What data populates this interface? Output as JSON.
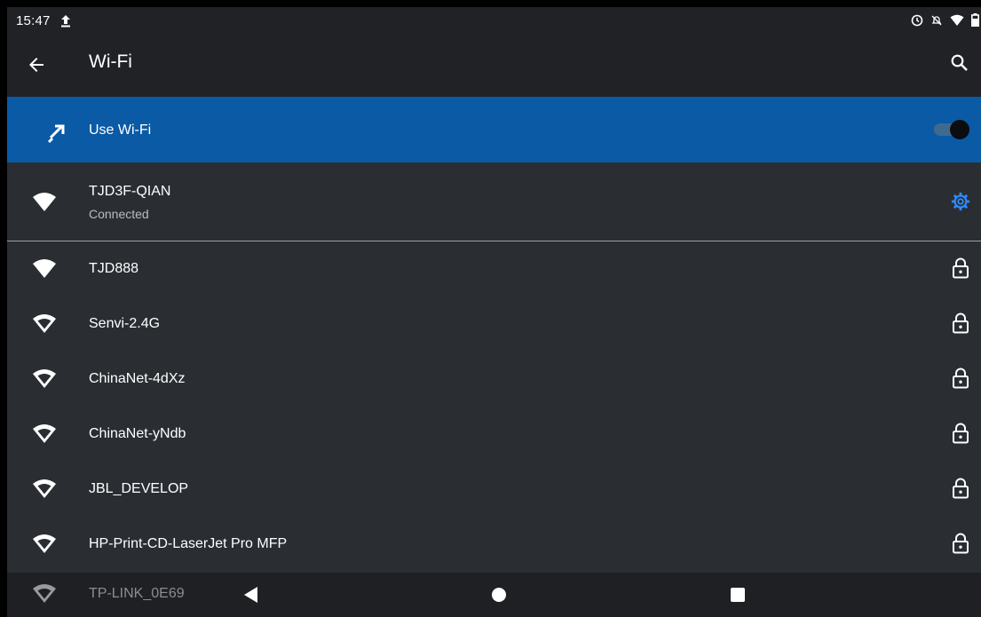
{
  "status_bar": {
    "time": "15:47",
    "icons": [
      "upload-icon",
      "alarm-icon",
      "notifications-off-icon",
      "wifi-signal-icon",
      "battery-icon"
    ]
  },
  "app_bar": {
    "title": "Wi-Fi",
    "back_icon": "arrow-back-icon",
    "search_icon": "search-icon"
  },
  "use_wifi": {
    "label": "Use Wi-Fi",
    "enabled": true,
    "accent_color": "#0a5aa6"
  },
  "connected_network": {
    "name": "TJD3F-QIAN",
    "status": "Connected",
    "settings_icon": "gear-icon",
    "accent_color": "#2d8cff"
  },
  "networks": [
    {
      "name": "TJD888",
      "signal": "full",
      "locked": true
    },
    {
      "name": "Senvi-2.4G",
      "signal": "medium",
      "locked": true
    },
    {
      "name": "ChinaNet-4dXz",
      "signal": "medium",
      "locked": true
    },
    {
      "name": "ChinaNet-yNdb",
      "signal": "medium",
      "locked": true
    },
    {
      "name": "JBL_DEVELOP",
      "signal": "medium",
      "locked": true
    },
    {
      "name": "HP-Print-CD-LaserJet Pro MFP",
      "signal": "medium",
      "locked": true
    }
  ],
  "peek_network": {
    "name": "TP-LINK_0E69"
  },
  "nav_bar": {
    "buttons": [
      "nav-back-button",
      "nav-home-button",
      "nav-recents-button"
    ]
  }
}
